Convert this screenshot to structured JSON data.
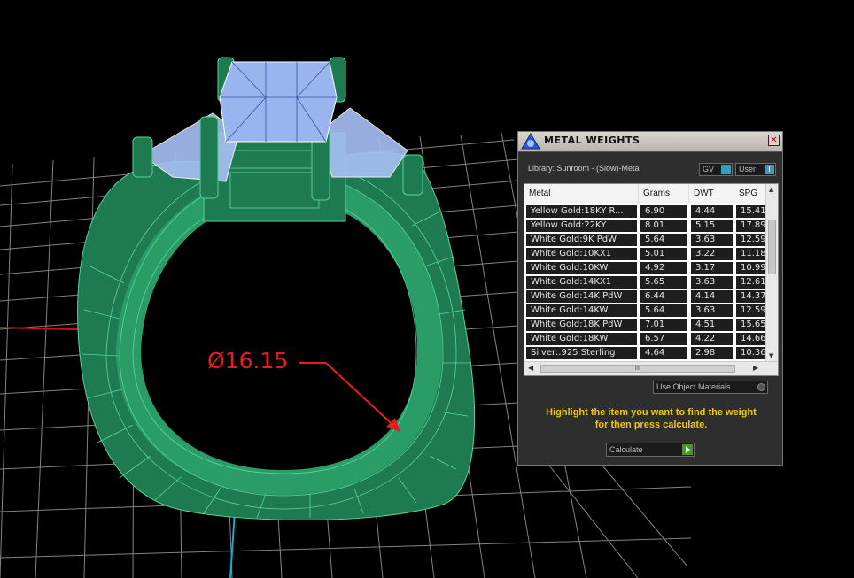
{
  "viewport": {
    "dimension_label": "Ø16.15"
  },
  "panel": {
    "title": "METAL WEIGHTS",
    "close_glyph": "✕",
    "library_label": "Library: Sunroom - (Slow)-Metal",
    "gv_label": "GV",
    "user_label": "User",
    "toggle_glyph": "I",
    "columns": [
      "Metal",
      "Grams",
      "DWT",
      "SPG"
    ],
    "rows": [
      [
        "Yellow Gold:18KY R...",
        "6.90",
        "4.44",
        "15.41"
      ],
      [
        "Yellow Gold:22KY",
        "8.01",
        "5.15",
        "17.89"
      ],
      [
        "White Gold:9K PdW",
        "5.64",
        "3.63",
        "12.59"
      ],
      [
        "White Gold:10KX1",
        "5.01",
        "3.22",
        "11.18"
      ],
      [
        "White Gold:10KW",
        "4.92",
        "3.17",
        "10.99"
      ],
      [
        "White Gold:14KX1",
        "5.65",
        "3.63",
        "12.61"
      ],
      [
        "White Gold:14K PdW",
        "6.44",
        "4.14",
        "14.37"
      ],
      [
        "White Gold:14KW",
        "5.64",
        "3.63",
        "12.59"
      ],
      [
        "White Gold:18K PdW",
        "7.01",
        "4.51",
        "15.65"
      ],
      [
        "White Gold:18KW",
        "6.57",
        "4.22",
        "14.66"
      ],
      [
        "Silver:.925 Sterling",
        "4.64",
        "2.98",
        "10.36"
      ]
    ],
    "use_object_materials_label": "Use Object Materials",
    "hint_line1": "Highlight the item you want to find the weight",
    "hint_line2": "for then press calculate.",
    "calculate_label": "Calculate",
    "hscroll_grip": "III"
  },
  "colors": {
    "ring_green": "#1e7a50",
    "gem_blue": "#9ab4f0",
    "dimension_red": "#e81c1c",
    "hint_yellow": "#f0c419"
  }
}
